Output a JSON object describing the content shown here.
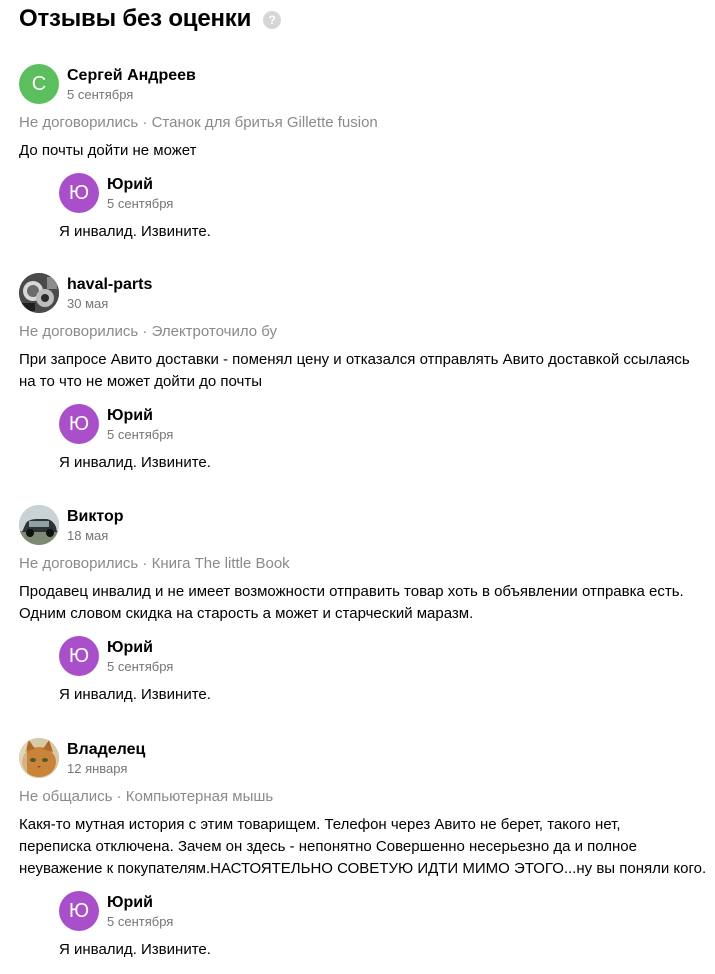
{
  "header": {
    "title": "Отзывы без оценки",
    "help_icon": "?"
  },
  "colors": {
    "green_avatar": "#5cbf5e",
    "purple_avatar": "#a94fc9",
    "muted_text": "#8a8a8a"
  },
  "reviews": [
    {
      "author": "Сергей Андреев",
      "avatar_letter": "С",
      "avatar_type": "letter-green",
      "date": "5 сентября",
      "status": "Не договорились",
      "separator": " · ",
      "item": "Станок для бритья Gillette fusion",
      "text": "До почты дойти не может",
      "reply": {
        "author": "Юрий",
        "avatar_letter": "Ю",
        "date": "5 сентября",
        "text": "Я инвалид. Извините."
      }
    },
    {
      "author": "haval-parts",
      "avatar_type": "photo-dark-parts",
      "date": "30 мая",
      "status": "Не договорились",
      "separator": " · ",
      "item": "Электроточило бу",
      "text": "При запросе Авито доставки - поменял цену и отказался отправлять Авито доставкой ссылаясь\nна то что не может дойти до почты",
      "reply": {
        "author": "Юрий",
        "avatar_letter": "Ю",
        "date": "5 сентября",
        "text": "Я инвалид. Извините."
      }
    },
    {
      "author": "Виктор",
      "avatar_type": "photo-car",
      "date": "18 мая",
      "status": "Не договорились",
      "separator": " · ",
      "item": "Книга The little Book",
      "text": "Продавец инвалид и не имеет возможности отправить товар хоть в объявлении отправка есть.\nОдним словом скидка на старость а может и старческий маразм.",
      "reply": {
        "author": "Юрий",
        "avatar_letter": "Ю",
        "date": "5 сентября",
        "text": "Я инвалид. Извините."
      }
    },
    {
      "author": "Владелец",
      "avatar_type": "photo-cat",
      "date": "12 января",
      "status": "Не общались",
      "separator": " · ",
      "item": "Компьютерная мышь",
      "text": "Какя-то мутная история с этим товарищем. Телефон через Авито не берет, такого нет,\nпереписка отключена. Зачем он здесь - непонятно Совершенно несерьезно да и полное\nнеуважение к покупателям.НАСТОЯТЕЛЬНО СОВЕТУЮ ИДТИ МИМО ЭТОГО...ну вы поняли кого.",
      "reply": {
        "author": "Юрий",
        "avatar_letter": "Ю",
        "date": "5 сентября",
        "text": "Я инвалид. Извините."
      }
    }
  ]
}
